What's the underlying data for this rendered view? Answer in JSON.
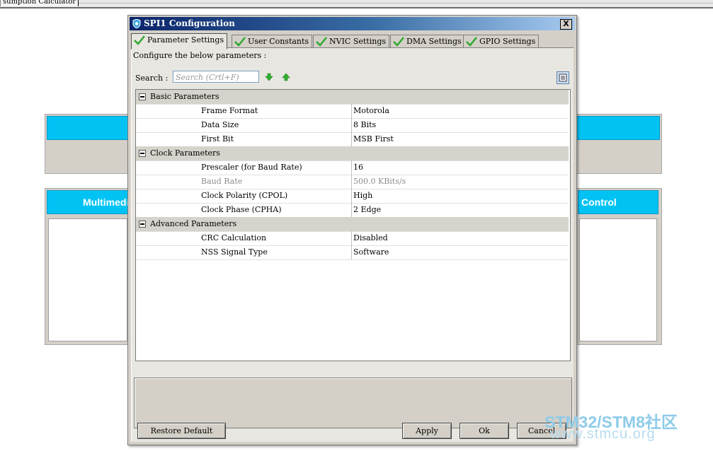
{
  "app": {
    "top_tab_label": "sumption Calculator"
  },
  "background": {
    "panel_left_title": "Multimedi",
    "panel_right_title": "Control"
  },
  "dialog": {
    "title": "SPI1 Configuration",
    "close_glyph": "X",
    "tabs": [
      {
        "label": "Parameter Settings",
        "active": true
      },
      {
        "label": "User Constants",
        "active": false
      },
      {
        "label": "NVIC Settings",
        "active": false
      },
      {
        "label": "DMA Settings",
        "active": false
      },
      {
        "label": "GPIO Settings",
        "active": false
      }
    ],
    "configure_text": "Configure the below parameters :",
    "search_label": "Search :",
    "search_placeholder": "Search (Crtl+F)",
    "groups": [
      {
        "name": "Basic Parameters",
        "params": [
          {
            "name": "Frame Format",
            "value": "Motorola",
            "disabled": false
          },
          {
            "name": "Data Size",
            "value": "8 Bits",
            "disabled": false
          },
          {
            "name": "First Bit",
            "value": "MSB First",
            "disabled": false
          }
        ]
      },
      {
        "name": "Clock Parameters",
        "params": [
          {
            "name": "Prescaler (for Baud Rate)",
            "value": "16",
            "disabled": false
          },
          {
            "name": "Baud Rate",
            "value": "500.0 KBits/s",
            "disabled": true
          },
          {
            "name": "Clock Polarity (CPOL)",
            "value": "High",
            "disabled": false
          },
          {
            "name": "Clock Phase (CPHA)",
            "value": "2 Edge",
            "disabled": false
          }
        ]
      },
      {
        "name": "Advanced Parameters",
        "params": [
          {
            "name": "CRC Calculation",
            "value": "Disabled",
            "disabled": false
          },
          {
            "name": "NSS Signal Type",
            "value": "Software",
            "disabled": false
          }
        ]
      }
    ],
    "buttons": {
      "restore": "Restore Default",
      "apply": "Apply",
      "ok": "Ok",
      "cancel": "Cancel"
    }
  },
  "watermark": {
    "line1": "STM32/STM8社区",
    "line2": "www.stmcu.org"
  },
  "colors": {
    "title_gradient_start": "#0a246a",
    "panel_header": "#00c3f4",
    "check_green": "#2fa82f"
  }
}
